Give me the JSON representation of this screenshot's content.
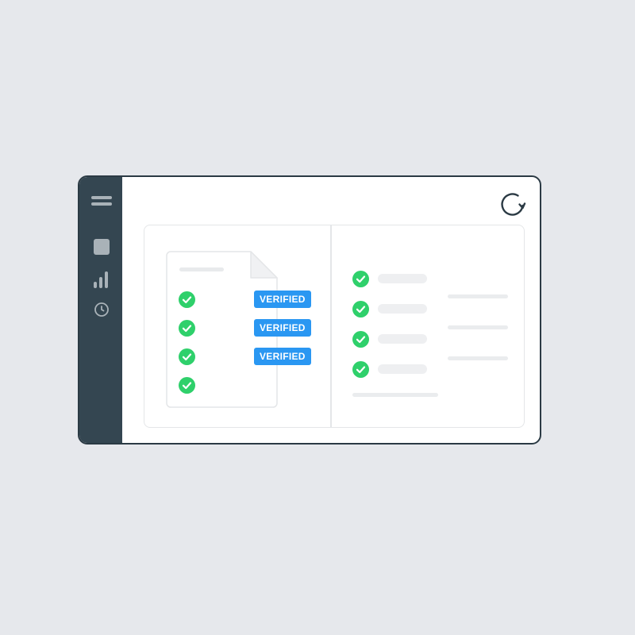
{
  "window": {
    "sidebar": {
      "items": [
        {
          "icon": "menu-icon"
        },
        {
          "icon": "square-icon"
        },
        {
          "icon": "bar-chart-icon"
        },
        {
          "icon": "clock-icon"
        }
      ],
      "background": "#344651",
      "icon_color": "#a9b2b8"
    },
    "toolbar": {
      "refresh_icon": "refresh-icon"
    },
    "document": {
      "check_items": [
        {
          "checked": true,
          "badge": "VERIFIED"
        },
        {
          "checked": true,
          "badge": "VERIFIED"
        },
        {
          "checked": true,
          "badge": "VERIFIED"
        },
        {
          "checked": true
        }
      ]
    },
    "checklist": {
      "items": [
        {
          "checked": true
        },
        {
          "checked": true
        },
        {
          "checked": true
        },
        {
          "checked": true
        }
      ]
    }
  },
  "colors": {
    "background": "#e6e8ec",
    "accent": "#2a97f2",
    "success": "#2fd06b",
    "frame": "#2b3a44"
  }
}
